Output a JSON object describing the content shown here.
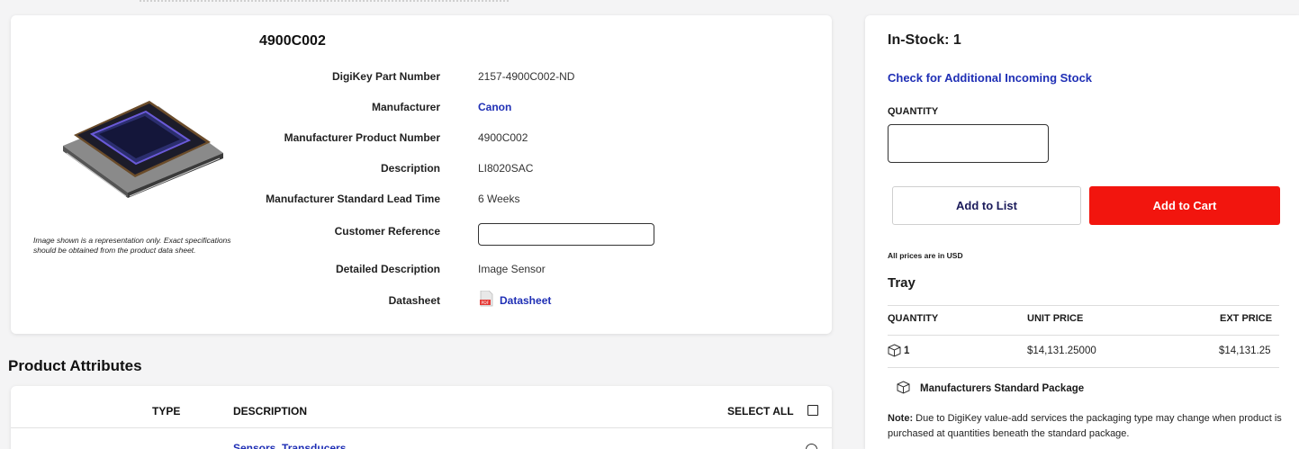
{
  "product": {
    "part_number": "4900C002",
    "image_note": "Image shown is a representation only. Exact specifications should be obtained from the product data sheet.",
    "specs": {
      "digikey_pn_label": "DigiKey Part Number",
      "digikey_pn_value": "2157-4900C002-ND",
      "manufacturer_label": "Manufacturer",
      "manufacturer_value": "Canon",
      "mpn_label": "Manufacturer Product Number",
      "mpn_value": "4900C002",
      "description_label": "Description",
      "description_value": "LI8020SAC",
      "lead_time_label": "Manufacturer Standard Lead Time",
      "lead_time_value": "6 Weeks",
      "customer_ref_label": "Customer Reference",
      "customer_ref_value": "",
      "detailed_desc_label": "Detailed Description",
      "detailed_desc_value": "Image Sensor",
      "datasheet_label": "Datasheet",
      "datasheet_link": "Datasheet"
    }
  },
  "attributes": {
    "title": "Product Attributes",
    "col_type": "TYPE",
    "col_description": "DESCRIPTION",
    "select_all": "SELECT ALL",
    "first_category": "Sensors, Transducers"
  },
  "buy": {
    "in_stock": "In-Stock: 1",
    "check_incoming": "Check for Additional Incoming Stock",
    "quantity_label": "QUANTITY",
    "quantity_value": "",
    "add_to_list": "Add to List",
    "add_to_cart": "Add to Cart",
    "prices_note": "All prices are in USD",
    "packaging": "Tray",
    "price_table": {
      "headers": [
        "QUANTITY",
        "UNIT PRICE",
        "EXT PRICE"
      ],
      "rows": [
        {
          "qty": "1",
          "unit": "$14,131.25000",
          "ext": "$14,131.25"
        }
      ]
    },
    "standard_package": "Manufacturers Standard Package",
    "note_label": "Note:",
    "note_text": " Due to DigiKey value-add services the packaging type may change when product is purchased at quantities beneath the standard package."
  },
  "colors": {
    "link": "#1f2fb5",
    "cart_button": "#f2150e",
    "page_bg": "#f4f4f5"
  },
  "icons": [
    "pdf-icon",
    "package-box-icon",
    "checkbox-icon",
    "radio-icon"
  ]
}
